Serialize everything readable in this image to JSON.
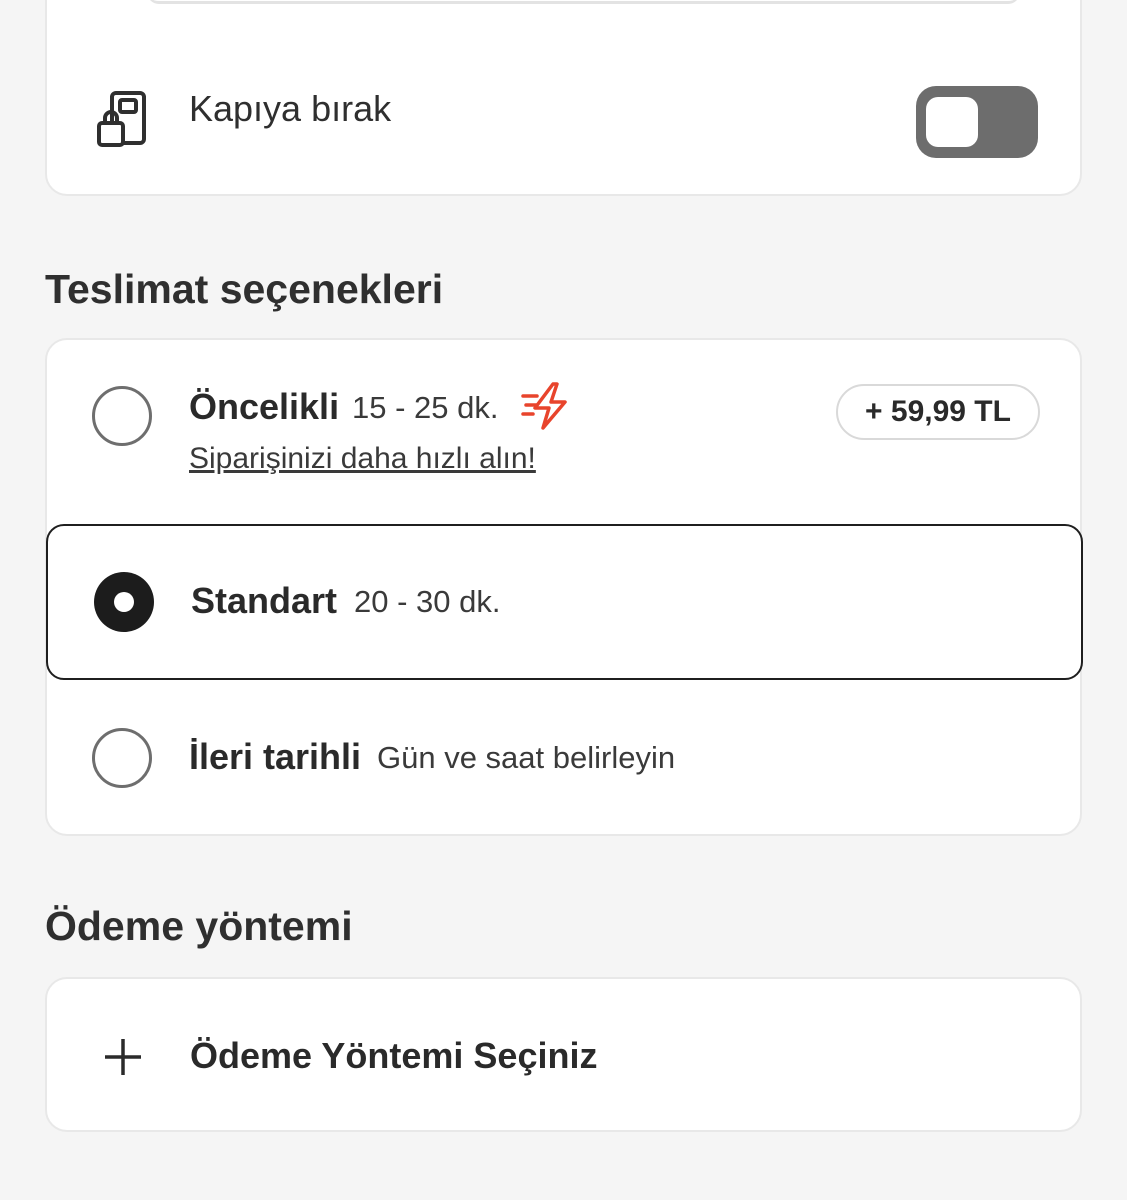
{
  "door_option": {
    "label": "Kapıya bırak",
    "icon": "door-drop-icon",
    "toggle_on": false
  },
  "delivery": {
    "title": "Teslimat seçenekleri",
    "options": [
      {
        "name": "Öncelikli",
        "time": "15 - 25 dk.",
        "subtitle": "Siparişinizi daha hızlı alın!",
        "price": "+ 59,99 TL",
        "icon": "fast-bolt-icon",
        "selected": false
      },
      {
        "name": "Standart",
        "time": "20 - 30 dk.",
        "selected": true
      },
      {
        "name": "İleri tarihli",
        "time": "Gün ve saat belirleyin",
        "selected": false
      }
    ]
  },
  "payment": {
    "title": "Ödeme yöntemi",
    "select_label": "Ödeme Yöntemi Seçiniz",
    "icon": "plus-icon"
  },
  "colors": {
    "background": "#f5f5f5",
    "card": "#ffffff",
    "accent_bolt": "#e8442c",
    "toggle_off": "#6d6d6d",
    "selected_border": "#1f1f1f"
  }
}
